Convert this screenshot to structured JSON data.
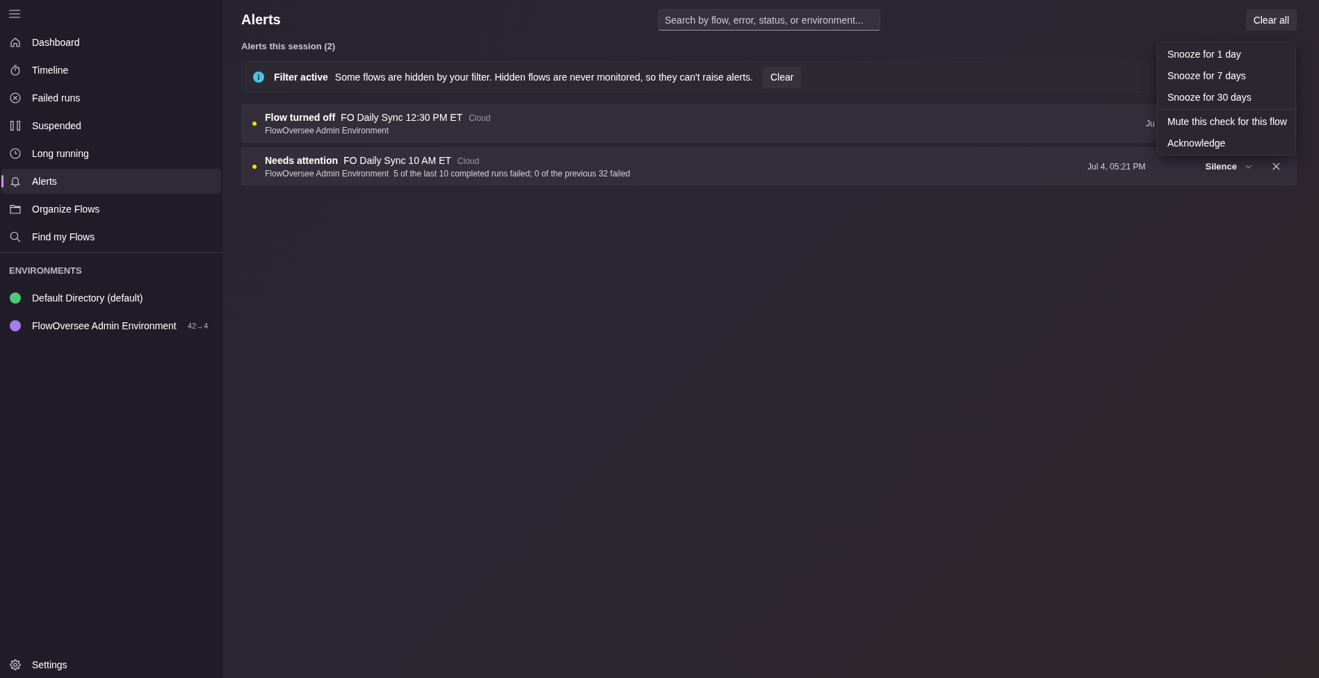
{
  "sidebar": {
    "nav_items": [
      {
        "label": "Dashboard",
        "selected": false
      },
      {
        "label": "Timeline",
        "selected": false
      },
      {
        "label": "Failed runs",
        "selected": false
      },
      {
        "label": "Suspended",
        "selected": false
      },
      {
        "label": "Long running",
        "selected": false
      },
      {
        "label": "Alerts",
        "selected": true
      },
      {
        "label": "Organize Flows",
        "selected": false
      },
      {
        "label": "Find my Flows",
        "selected": false
      }
    ],
    "section_title": "ENVIRONMENTS",
    "environments": [
      {
        "name": "Default Directory (default)",
        "color": "#4fc878"
      },
      {
        "name": "FlowOversee Admin Environment",
        "color": "#a47ef0",
        "count": "42→4"
      }
    ],
    "settings": "Settings"
  },
  "header": {
    "title": "Alerts",
    "search_placeholder": "Search by flow, error, status, or environment...",
    "clear_all": "Clear all"
  },
  "session_heading": "Alerts this session (2)",
  "filter_banner": {
    "title": "Filter active",
    "message": "Some flows are hidden by your filter. Hidden flows are never monitored, so they can't raise alerts.",
    "button": "Clear"
  },
  "alerts": [
    {
      "status": "Flow turned off",
      "flow": "FO Daily Sync 12:30 PM ET",
      "tag": "Cloud",
      "color": "#f5dc00",
      "environment": "FlowOversee Admin Environment",
      "time": "Ju"
    },
    {
      "status": "Needs attention",
      "flow": "FO Daily Sync 10 AM ET",
      "tag": "Cloud",
      "color": "#f5dc00",
      "environment": "FlowOversee Admin Environment",
      "detail": "5 of the last 10 completed runs failed; 0 of the previous 32 failed",
      "time": "Jul 4, 05:21 PM",
      "silence": {
        "label": "Silence",
        "expanded": true,
        "menu": [
          {
            "items": [
              "Snooze for 1 day",
              "Snooze for 7 days",
              "Snooze for 30 days"
            ]
          },
          {
            "items": [
              "Mute this check for this flow",
              "Acknowledge"
            ]
          }
        ]
      },
      "dismiss_button": true
    }
  ]
}
